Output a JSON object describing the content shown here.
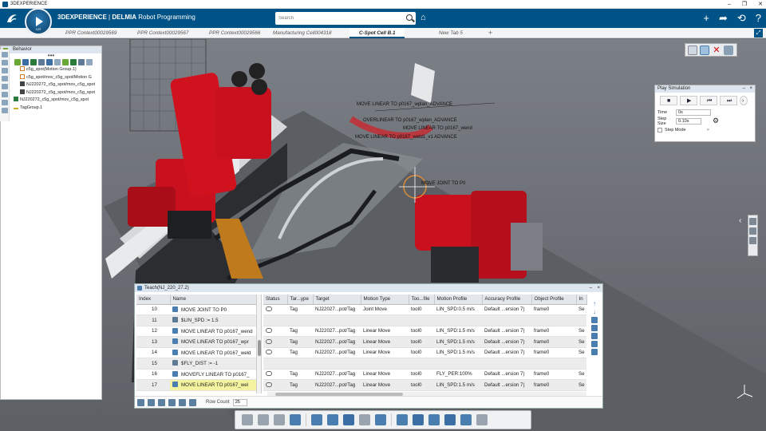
{
  "os": {
    "title": "3DEXPERIENCE",
    "controls": [
      "–",
      "❐",
      "✕"
    ]
  },
  "header": {
    "brand_bold": "3DEXPERIENCE",
    "brand_sep": " | ",
    "brand_app": "DELMIA",
    "brand_module": " Robot Programming",
    "compass_label": "V,R",
    "search_placeholder": "Search"
  },
  "tabs": [
    {
      "label": "PPR Context00029569",
      "active": false
    },
    {
      "label": "PPR Context00029567",
      "active": false
    },
    {
      "label": "PPR Context00029566",
      "active": false
    },
    {
      "label": "Manufacturing Cell004318",
      "active": false
    },
    {
      "label": "C-Spot Cell B.1",
      "active": true
    },
    {
      "label": "New Tab 5",
      "active": false
    }
  ],
  "behavior": {
    "title": "Behavior",
    "dots": "•••",
    "tree": [
      "c5g_spot(Motion Group.1)",
      "c5g_spot/mov_c5g_spot/Motion G",
      "NJ220272_c5g_spot/mov_c5g_spot",
      "NJ220272_c5g_spot/mov_c5g_spot",
      "NJ220272_c5g_spot/mov_c5g_spot",
      "TagGroup.1"
    ]
  },
  "viewport_labels": [
    "MOVE LINEAR TO p0167_wplan_ADVANCE",
    "OVERLINEAR TO p0167_wplan_ADVANCE",
    "MOVE LINEAR TO p0167_wend",
    "MOVE LINEAR TO p0167_weld1_v1 ADVANCE",
    "MOVE JOINT TO P0"
  ],
  "play_simulation": {
    "title": "Play Simulation",
    "time_label": "Time",
    "time_value": "0s",
    "step_size_label": "Step Size",
    "step_size_value": "0.10s",
    "step_mode_label": "Step Mode"
  },
  "teach": {
    "title": "Teach(NJ_220_27.2)",
    "left_headers": [
      "Index",
      "Name"
    ],
    "right_headers": [
      "Status",
      "Tar...ype",
      "Target",
      "Motion Type",
      "Too...file",
      "Motion Profile",
      "Accuracy Profile",
      "Object Profile",
      "In"
    ],
    "rows": [
      {
        "index": "10",
        "name": "MOVE JOINT TO P0",
        "kind": "move",
        "status": "",
        "target_type": "Tag",
        "target": "NJ22027...pot/Tag",
        "motion_type": "Joint Move",
        "tool": "tool0",
        "motion_profile": "LIN_SPD:0.5 m/s",
        "accuracy": "Default ...ersion 7)",
        "object": "frame0",
        "in": "Se"
      },
      {
        "index": "11",
        "name": "$LIN_SPD := 1.5",
        "kind": "stmt",
        "status": "",
        "target_type": "",
        "target": "",
        "motion_type": "",
        "tool": "",
        "motion_profile": "",
        "accuracy": "",
        "object": "",
        "in": ""
      },
      {
        "index": "12",
        "name": "MOVE LINEAR TO p0167_wend",
        "kind": "move",
        "status": "",
        "target_type": "Tag",
        "target": "NJ22027...pot/Tag",
        "motion_type": "Linear Move",
        "tool": "tool0",
        "motion_profile": "LIN_SPD:1.5 m/s",
        "accuracy": "Default ...ersion 7)",
        "object": "frame0",
        "in": "Se"
      },
      {
        "index": "13",
        "name": "MOVE LINEAR TO p0167_wpr",
        "kind": "move",
        "status": "",
        "target_type": "Tag",
        "target": "NJ22027...pot/Tag",
        "motion_type": "Linear Move",
        "tool": "tool0",
        "motion_profile": "LIN_SPD:1.5 m/s",
        "accuracy": "Default ...ersion 7)",
        "object": "frame0",
        "in": "Se"
      },
      {
        "index": "14",
        "name": "MOVE LINEAR TO p0167_weld",
        "kind": "move",
        "status": "",
        "target_type": "Tag",
        "target": "NJ22027...pot/Tag",
        "motion_type": "Linear Move",
        "tool": "tool0",
        "motion_profile": "LIN_SPD:1.5 m/s",
        "accuracy": "Default ...ersion 7)",
        "object": "frame0",
        "in": "Se"
      },
      {
        "index": "15",
        "name": "$FLY_DIST := -1",
        "kind": "stmt",
        "status": "",
        "target_type": "",
        "target": "",
        "motion_type": "",
        "tool": "",
        "motion_profile": "",
        "accuracy": "",
        "object": "",
        "in": ""
      },
      {
        "index": "16",
        "name": "MOVEFLY LINEAR TO p0167_",
        "kind": "move",
        "status": "",
        "target_type": "Tag",
        "target": "NJ22027...pot/Tag",
        "motion_type": "Linear Move",
        "tool": "tool0",
        "motion_profile": "FLY_PER:100%",
        "accuracy": "Default ...ersion 7)",
        "object": "frame0",
        "in": "Se"
      },
      {
        "index": "17",
        "name": "MOVE LINEAR TO p0167_wel",
        "kind": "move",
        "status": "",
        "target_type": "Tag",
        "target": "NJ22027...pot/Tag",
        "motion_type": "Linear Move",
        "tool": "tool0",
        "motion_profile": "LIN_SPD:1.5 m/s",
        "accuracy": "Default ...ersion 7)",
        "object": "frame0",
        "in": "Se"
      }
    ],
    "row_count_label": "Row Count",
    "row_count_value": "25"
  },
  "colors": {
    "brand": "#005386",
    "robot_red": "#c8101e",
    "panel_header": "#dde6ee",
    "highlight": "#f3f3a0"
  }
}
